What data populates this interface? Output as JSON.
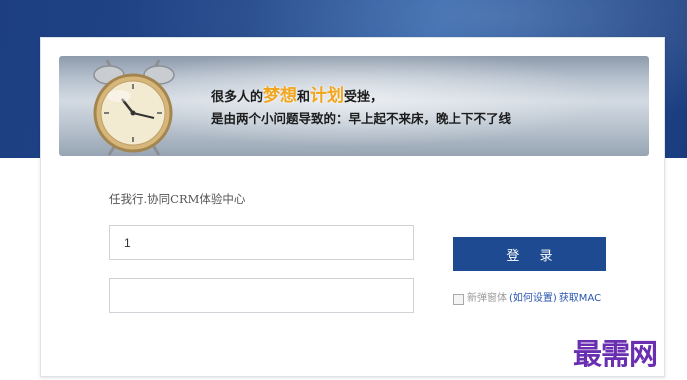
{
  "banner": {
    "slogan_line1_pre": "很多人的",
    "slogan_dream": "梦想",
    "slogan_and": "和",
    "slogan_plan": "计划",
    "slogan_line1_post": "受挫，",
    "slogan_line2": "是由两个小问题导致的：早上起不来床，晚上下不了线"
  },
  "login": {
    "site_title": "任我行.协同CRM体验中心",
    "username_value": "1",
    "password_value": "",
    "login_button": "登 录",
    "new_window_label": "新弹窗体",
    "how_to_link": "(如何设置)",
    "get_mac_link": "获取MAC"
  },
  "watermark": "最需网",
  "colors": {
    "header_blue": "#1f4588",
    "button_blue": "#1d4a91",
    "highlight_orange": "#f2a51a",
    "link_blue": "#2a56b0",
    "watermark_purple": "#6a2fb0"
  },
  "icons": {
    "clock": "alarm-clock-icon",
    "checkbox": "checkbox-icon"
  }
}
